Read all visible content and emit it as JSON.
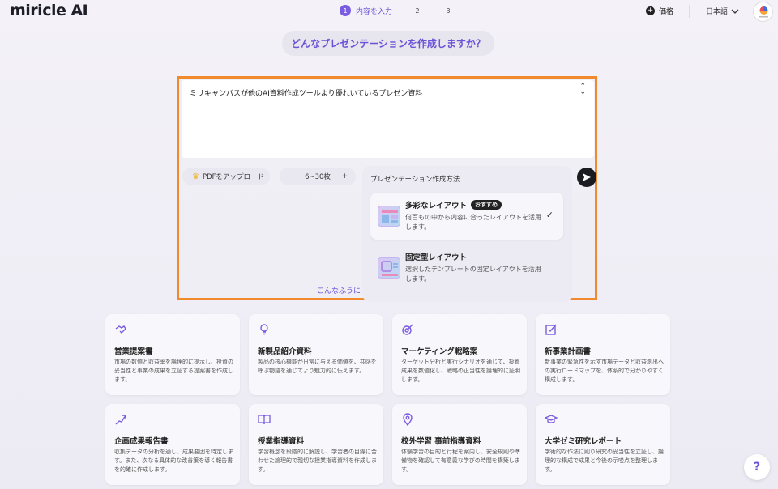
{
  "header": {
    "logo": "miricle AI",
    "steps": [
      {
        "num": "1",
        "label": "内容を入力"
      },
      {
        "num": "2",
        "label": ""
      },
      {
        "num": "3",
        "label": ""
      }
    ],
    "price_label": "価格",
    "language": "日本語"
  },
  "question": "どんなプレゼンテーションを作成しますか？",
  "prompt": {
    "value": "ミリキャンバスが他のAI資料作成ツールより優れいているプレゼン資料"
  },
  "controls": {
    "pdf_upload": "PDFをアップロード",
    "slide_count": "6~30枚",
    "minus": "−",
    "plus": "+"
  },
  "method_panel": {
    "title": "プレゼンテーション作成方法",
    "options": [
      {
        "title": "多彩なレイアウト",
        "badge": "おすすめ",
        "desc": "何百もの中から内容に合ったレイアウトを活用します。",
        "selected": true
      },
      {
        "title": "固定型レイアウト",
        "badge": "",
        "desc": "選択したテンプレートの固定レイアウトを活用します。",
        "selected": false
      }
    ]
  },
  "peek_text": "こんなふうに",
  "templates": [
    {
      "icon": "handshake-icon",
      "title": "営業提案書",
      "desc": "市場の数値と収益率を論理的に提示し、投資の妥当性と事業の成果を立証する提案書を作成します。"
    },
    {
      "icon": "lightbulb-icon",
      "title": "新製品紹介資料",
      "desc": "製品の核心機能が日常に与える価値を、共感を呼ぶ物語を通じてより魅力的に伝えます。"
    },
    {
      "icon": "target-icon",
      "title": "マーケティング戦略案",
      "desc": "ターゲット分析と実行シナリオを通じて、投資成果を数値化し、戦略の正当性を論理的に証明します。"
    },
    {
      "icon": "checklist-icon",
      "title": "新事業計画書",
      "desc": "新事業の緊急性を示す市場データと収益創出への実行ロードマップを、体系的で分かりやすく構成します。"
    },
    {
      "icon": "growth-chart-icon",
      "title": "企画成果報告書",
      "desc": "収集データの分析を通し、成果要因を特定します。また、次なる具体的な改善策を導く報告書を的確に作成します。"
    },
    {
      "icon": "book-icon",
      "title": "授業指導資料",
      "desc": "学習概念を段階的に解説し、学習者の目線に合わせた論理的で親切な授業指導資料を作成します。"
    },
    {
      "icon": "location-pin-icon",
      "title": "校外学習 事前指導資料",
      "desc": "体験学習の目的と行程を案内し、安全規則や準備物を確認して有意義な学びの時間を構築します。"
    },
    {
      "icon": "graduation-cap-icon",
      "title": "大学ゼミ研究レポート",
      "desc": "学術的な作法に則り研究の妥当性を立証し、論理的な構成で成果と今後の示唆点を整理します。"
    }
  ],
  "help": "?"
}
